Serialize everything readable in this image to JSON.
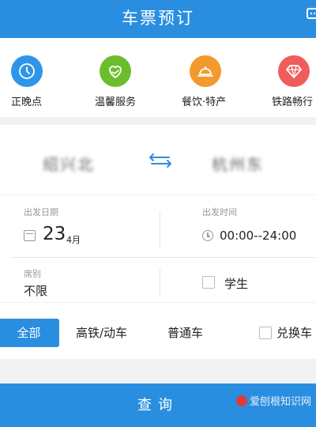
{
  "header": {
    "title": "车票预订"
  },
  "services": [
    {
      "label": "正晚点",
      "icon": "clock-icon",
      "color": "#2f95e8"
    },
    {
      "label": "温馨服务",
      "icon": "heart-hand-icon",
      "color": "#6cbd2e"
    },
    {
      "label": "餐饮·特产",
      "icon": "food-cloche-icon",
      "color": "#f29a2e"
    },
    {
      "label": "铁路畅行",
      "icon": "diamond-icon",
      "color": "#f05c5c"
    }
  ],
  "route": {
    "from": "绍兴北",
    "to": "杭州东"
  },
  "date": {
    "label": "出发日期",
    "day": "23",
    "month": "4月"
  },
  "time": {
    "label": "出发时间",
    "value": "00:00--24:00"
  },
  "seat": {
    "label": "席别",
    "value": "不限"
  },
  "student": {
    "label": "学生",
    "checked": false
  },
  "train_types": {
    "all": "全部",
    "high_speed": "高铁/动车",
    "normal": "普通车",
    "exchange": "兑换车"
  },
  "query": {
    "label": "查询"
  },
  "watermark": {
    "text": "爱刨根知识网"
  }
}
